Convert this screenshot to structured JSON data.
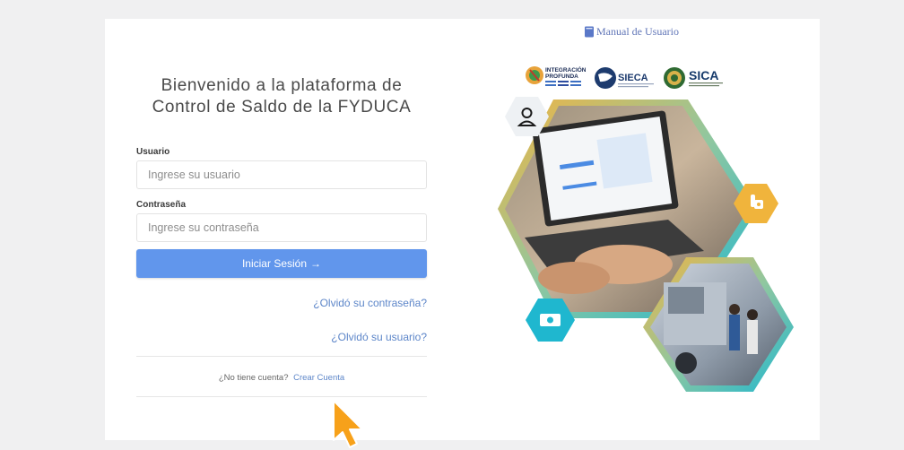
{
  "header": {
    "manual_label": "Manual de Usuario"
  },
  "welcome": {
    "line1": "Bienvenido a la plataforma de",
    "line2": "Control de Saldo de la FYDUCA"
  },
  "form": {
    "user_label": "Usuario",
    "user_placeholder": "Ingrese su usuario",
    "user_value": "",
    "password_label": "Contraseña",
    "password_placeholder": "Ingrese su contraseña",
    "password_value": "",
    "login_button": "Iniciar Sesión",
    "login_arrow": "→",
    "forgot_password": "¿Olvidó su contraseña?",
    "forgot_user": "¿Olvidó su usuario?",
    "no_account": "¿No tiene cuenta?",
    "create_account": "Crear Cuenta"
  },
  "logos": {
    "integracion_line1": "INTEGRACIÓN",
    "integracion_line2": "PROFUNDA",
    "sieca": "SIECA",
    "sica": "SICA"
  },
  "colors": {
    "accent": "#6196ec",
    "link": "#5d86c9",
    "hex_gold": "#f0b43c",
    "hex_teal": "#1fb7cf",
    "page_bg": "#f0f0f1"
  },
  "icons": [
    "book-icon",
    "user-icon",
    "hand-money-icon",
    "banknote-icon",
    "arrow-right-icon",
    "mouse-cursor-icon"
  ]
}
